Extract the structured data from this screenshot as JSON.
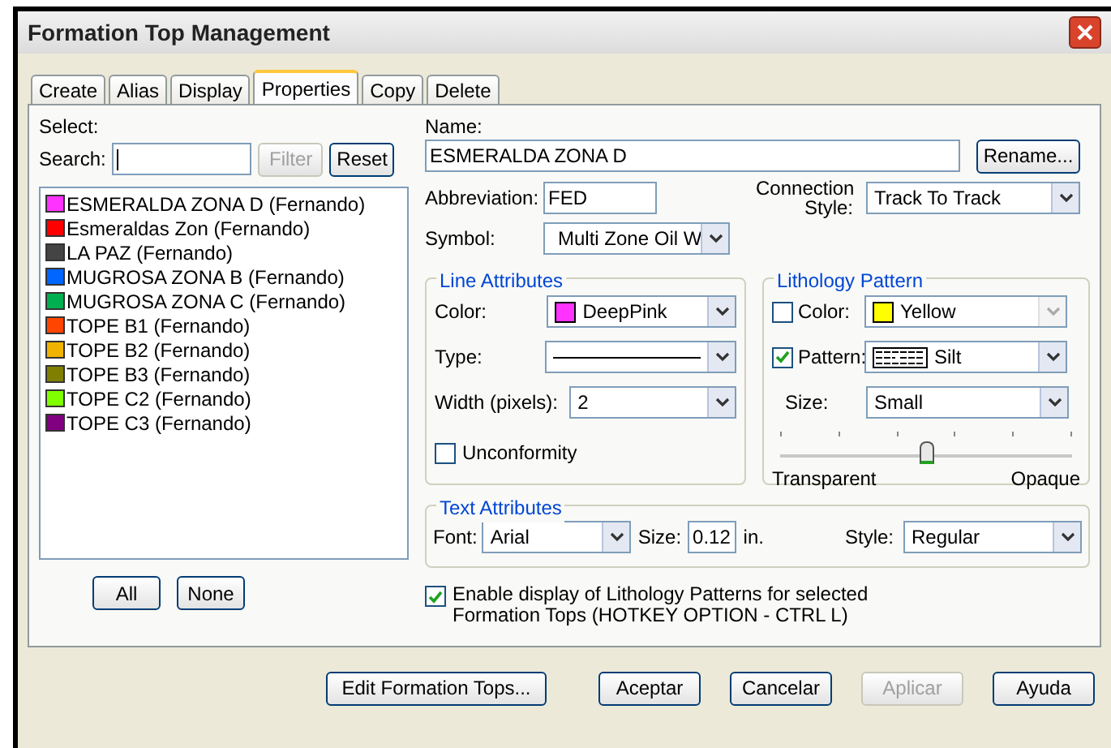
{
  "window": {
    "title": "Formation Top Management"
  },
  "tabs": [
    {
      "label": "Create",
      "selected": false
    },
    {
      "label": "Alias",
      "selected": false
    },
    {
      "label": "Display",
      "selected": false
    },
    {
      "label": "Properties",
      "selected": true
    },
    {
      "label": "Copy",
      "selected": false
    },
    {
      "label": "Delete",
      "selected": false
    }
  ],
  "select": {
    "label": "Select:",
    "search_label": "Search:",
    "filter_button": {
      "label": "Filter",
      "disabled": true
    },
    "reset_button": {
      "label": "Reset",
      "disabled": false
    }
  },
  "formation_list": [
    {
      "label": "ESMERALDA ZONA D (Fernando)",
      "color": "#ff33ff"
    },
    {
      "label": "Esmeraldas Zon (Fernando)",
      "color": "#ff0000"
    },
    {
      "label": "LA PAZ (Fernando)",
      "color": "#444444"
    },
    {
      "label": "MUGROSA ZONA B (Fernando)",
      "color": "#0066ff"
    },
    {
      "label": "MUGROSA ZONA C (Fernando)",
      "color": "#00b050"
    },
    {
      "label": "TOPE B1 (Fernando)",
      "color": "#ff4500"
    },
    {
      "label": "TOPE B2 (Fernando)",
      "color": "#f0b400"
    },
    {
      "label": "TOPE B3 (Fernando)",
      "color": "#808000"
    },
    {
      "label": "TOPE C2 (Fernando)",
      "color": "#80ff00"
    },
    {
      "label": "TOPE C3 (Fernando)",
      "color": "#800080"
    }
  ],
  "list_buttons": [
    "All",
    "None"
  ],
  "name": {
    "label": "Name:",
    "value": "ESMERALDA ZONA D",
    "rename_button": "Rename..."
  },
  "abbreviation": {
    "label": "Abbreviation:",
    "value": "FED"
  },
  "connection_style": {
    "label_lines": [
      "Connection",
      "Style:"
    ],
    "value": "Track To Track"
  },
  "symbol": {
    "label": "Symbol:",
    "value": "Multi Zone Oil W"
  },
  "line_attributes": {
    "title": "Line Attributes",
    "color_label": "Color:",
    "color_value": "DeepPink",
    "color": "#ff33ff",
    "type_label": "Type:",
    "width_label": "Width (pixels):",
    "width_value": "2",
    "unconformity": {
      "label": "Unconformity",
      "checked": false
    }
  },
  "lithology_pattern": {
    "title": "Lithology Pattern",
    "color": {
      "label": "Color:",
      "checked": false,
      "value": "Yellow",
      "color": "#ffff00",
      "disabled": true
    },
    "pattern": {
      "label": "Pattern:",
      "checked": true,
      "value": "Silt"
    },
    "size_label": "Size:",
    "size_value": "Small",
    "opacity": {
      "level": 0.5,
      "min_label": "Transparent",
      "max_label": "Opaque"
    }
  },
  "text_attributes": {
    "title": "Text Attributes",
    "font_label": "Font:",
    "font_value": "Arial",
    "size_label": "Size:",
    "size_value": "0.12",
    "unit": "in.",
    "style_label": "Style:",
    "style_value": "Regular"
  },
  "enable_lithology": {
    "label": "Enable display of Lithology Patterns for selected Formation Tops (HOTKEY OPTION - CTRL L)",
    "checked": true
  },
  "buttons": [
    {
      "label": "Edit Formation Tops...",
      "disabled": false
    },
    {
      "label": "Aceptar",
      "disabled": false
    },
    {
      "label": "Cancelar",
      "disabled": false
    },
    {
      "label": "Aplicar",
      "disabled": true
    },
    {
      "label": "Ayuda",
      "disabled": false
    }
  ]
}
